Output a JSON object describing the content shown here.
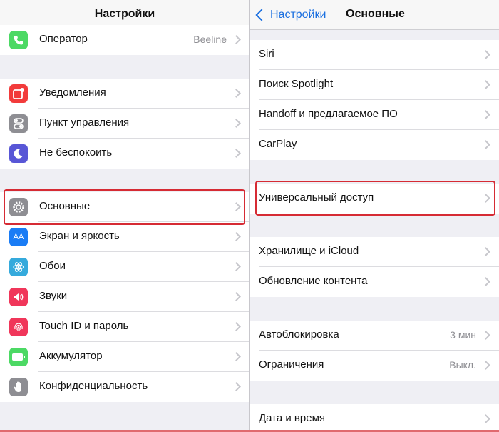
{
  "left": {
    "title": "Настройки",
    "rows": [
      {
        "label": "Оператор",
        "value": "Beeline",
        "icon": "phone-icon",
        "color": "#4cd964"
      },
      {
        "label": "Уведомления",
        "icon": "notifications-icon",
        "color": "#f23b3b"
      },
      {
        "label": "Пункт управления",
        "icon": "control-center-icon",
        "color": "#8e8e93"
      },
      {
        "label": "Не беспокоить",
        "icon": "moon-icon",
        "color": "#5856d6"
      },
      {
        "label": "Основные",
        "icon": "gear-icon",
        "color": "#8e8e93"
      },
      {
        "label": "Экран и яркость",
        "icon": "display-brightness-icon",
        "color": "#1a7cf5"
      },
      {
        "label": "Обои",
        "icon": "wallpaper-icon",
        "color": "#35aadc"
      },
      {
        "label": "Звуки",
        "icon": "speaker-icon",
        "color": "#f0365a"
      },
      {
        "label": "Touch ID и пароль",
        "icon": "fingerprint-icon",
        "color": "#f0365a"
      },
      {
        "label": "Аккумулятор",
        "icon": "battery-icon",
        "color": "#4cd964"
      },
      {
        "label": "Конфиденциальность",
        "icon": "hand-icon",
        "color": "#8e8e93"
      }
    ]
  },
  "right": {
    "back_label": "Настройки",
    "title": "Основные",
    "rows": [
      {
        "label": "Siri"
      },
      {
        "label": "Поиск Spotlight"
      },
      {
        "label": "Handoff и предлагаемое ПО"
      },
      {
        "label": "CarPlay"
      },
      {
        "label": "Универсальный доступ"
      },
      {
        "label": "Хранилище и iCloud"
      },
      {
        "label": "Обновление контента"
      },
      {
        "label": "Автоблокировка",
        "value": "3 мин"
      },
      {
        "label": "Ограничения",
        "value": "Выкл."
      },
      {
        "label": "Дата и время"
      }
    ]
  },
  "highlight_color": "#d62b34"
}
